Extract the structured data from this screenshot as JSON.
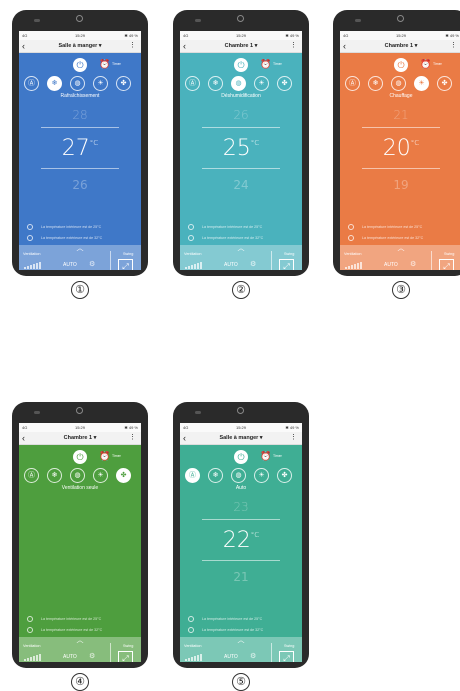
{
  "common": {
    "status_left": "4G",
    "status_time": "15:29",
    "status_right": "✱ 49 %",
    "timer_label": "Timer",
    "info_line1": "La température intérieure est de  25°C",
    "info_line2": "La température extérieure est de  32°C",
    "ventilation_label": "Ventilation",
    "fan_value": "AUTO",
    "swing_label": "Swing",
    "unit": "°C",
    "icons": [
      "power-icon",
      "alarm-clock-icon",
      "auto-mode-icon",
      "snowflake-icon",
      "drop-icon",
      "sun-icon",
      "fan-icon",
      "gear-icon",
      "swing-icon",
      "chevron-up-icon",
      "back-icon",
      "more-icon"
    ]
  },
  "phones": [
    {
      "number": "①",
      "room": "Salle à manger",
      "mode_label": "Rafraîchissement",
      "selected_mode": 1,
      "temp_up": "28",
      "temp": "27",
      "temp_down": "26",
      "bg": "#3f78c8"
    },
    {
      "number": "②",
      "room": "Chambre 1",
      "mode_label": "Déshumidification",
      "selected_mode": 2,
      "temp_up": "26",
      "temp": "25",
      "temp_down": "24",
      "bg": "#4ab2bd"
    },
    {
      "number": "③",
      "room": "Chambre 1",
      "mode_label": "Chauffage",
      "selected_mode": 3,
      "temp_up": "21",
      "temp": "20",
      "temp_down": "19",
      "bg": "#ea7b45"
    },
    {
      "number": "④",
      "room": "Chambre 1",
      "mode_label": "Ventilation seule",
      "selected_mode": 4,
      "temp_up": "",
      "temp": "",
      "temp_down": "",
      "bg": "#4e9e3e"
    },
    {
      "number": "⑤",
      "room": "Salle à manger",
      "mode_label": "Auto",
      "selected_mode": 0,
      "temp_up": "23",
      "temp": "22",
      "temp_down": "21",
      "bg": "#3fae94"
    }
  ]
}
